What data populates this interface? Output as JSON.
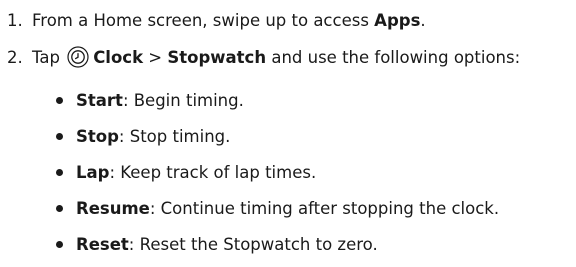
{
  "steps": [
    {
      "number": "1.",
      "text_before": "From a Home screen, swipe up to access ",
      "bold": "Apps",
      "text_after": "."
    },
    {
      "number": "2.",
      "text_before": "Tap ",
      "icon": "clock-icon",
      "bold_a": "Clock",
      "separator": " > ",
      "bold_b": "Stopwatch",
      "text_after": " and use the following options:"
    }
  ],
  "options": [
    {
      "name": "Start",
      "desc": ": Begin timing."
    },
    {
      "name": "Stop",
      "desc": ": Stop timing."
    },
    {
      "name": "Lap",
      "desc": ": Keep track of lap times."
    },
    {
      "name": "Resume",
      "desc": ": Continue timing after stopping the clock."
    },
    {
      "name": "Reset",
      "desc": ": Reset the Stopwatch to zero."
    }
  ]
}
